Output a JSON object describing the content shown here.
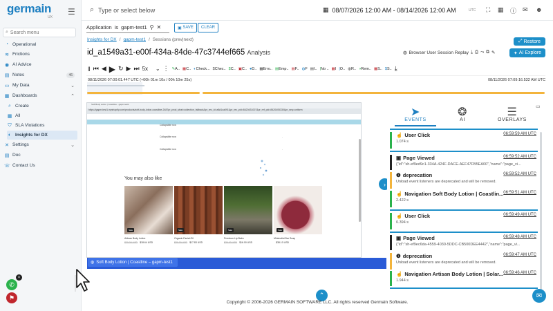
{
  "app": {
    "name": "germain",
    "sub": "UX"
  },
  "topbar": {
    "search_placeholder": "Type or select below",
    "daterange": "08/07/2026 12:00 AM - 08/14/2026 12:00 AM",
    "timezone": "UTC"
  },
  "sidebar": {
    "search": "Search menu",
    "items": [
      {
        "label": "Operational",
        "icon": "gauge-icon"
      },
      {
        "label": "Frictions",
        "icon": "friction-icon"
      },
      {
        "label": "AI Advice",
        "icon": "ai-icon"
      },
      {
        "label": "Notes",
        "icon": "note-icon",
        "badge": "46"
      },
      {
        "label": "My Data",
        "icon": "folder-icon"
      },
      {
        "label": "Dashboards",
        "icon": "dashboard-icon"
      },
      {
        "label": "Create",
        "icon": "search-icon"
      },
      {
        "label": "All",
        "icon": "grid-icon"
      },
      {
        "label": "SLA Violations",
        "icon": "shield-icon"
      },
      {
        "label": "Insights for DX",
        "icon": "insight-icon"
      },
      {
        "label": "Settings",
        "icon": "gear-icon"
      },
      {
        "label": "Doc",
        "icon": "doc-icon"
      },
      {
        "label": "Contact Us",
        "icon": "phone-icon"
      }
    ]
  },
  "filter": {
    "field": "Application",
    "op": "is",
    "value": "gapm-test1",
    "save": "SAVE",
    "clear": "CLEAR"
  },
  "breadcrumb": {
    "c1": "Insights for DX",
    "c2": "gapm-test1",
    "c3": "Sessions (prev|next)"
  },
  "restore_label": "Restore",
  "title": {
    "id": "id_a1549a31-e00f-434a-84de-47c3744ef665",
    "suffix": "Analysis"
  },
  "replay_label": "Browser User Session Replay",
  "ai_explore_label": "AI Explore",
  "player": {
    "speed": "5x",
    "chips": [
      "A..",
      "C..",
      "Check...",
      "Chec..",
      "C..",
      "C..",
      "D..",
      "Erro..",
      "Emp..",
      "F..",
      "F",
      "I..",
      "No ..",
      "I",
      "O..",
      "R..",
      "Rem..",
      "S..",
      "S.."
    ]
  },
  "timeline": {
    "start": "08/11/2026 07:00:01.447 UTC (+00h 01m 10s / 00h 10m 25s)",
    "end": "08/11/2026 07:09:16.532 AM UTC"
  },
  "frame": {
    "tab_title": "Soft Body Lotion | Coastline - gapm-test1",
    "url": "https://gapm-test1.myshopify.com/products/soft-body-lotion-coastline-2487pr_prod_strat=collection_fallback&pr_rec_id=a8d1ca091&pr_rec_pid=8420431007&pr_ref_pid=8420405330&pr_seq=uniform",
    "collapsible": [
      "Collapsible row",
      "Collapsible row",
      "Collapsible row"
    ],
    "may_like": "You may also like",
    "products": [
      {
        "name": "Artisan Body Lotion",
        "old": "$20.00 USD",
        "price": "$18.64 USD",
        "sale": "Sale"
      },
      {
        "name": "Organic Facial Oil",
        "old": "$20.00 USD",
        "price": "$17.83 USD",
        "sale": "Sale"
      },
      {
        "name": "Premium Lip Balm",
        "old": "$20.00 USD",
        "price": "$16.00 USD",
        "sale": "Sale"
      },
      {
        "name": "Minimalist Bar Soap",
        "old": "",
        "price": "$38.10 USD",
        "sale": "Sale"
      }
    ],
    "session_tab": "Soft Body Lotion | Coastline – gapm-test1"
  },
  "rpanel": {
    "tabs": [
      "EVENTS",
      "AI",
      "OVERLAYS"
    ],
    "events": [
      {
        "title": "User Click",
        "time": "06:59:59 AM UTC",
        "detail": "1.074 s",
        "icon": "click-icon"
      },
      {
        "title": "Page Viewed",
        "time": "06:59:52 AM UTC",
        "detail": "{\"id\":\"sh-ef9ed9c1-334A-424F-DACE-AEF47FB5EA00\",\"name\":\"page_vi...",
        "icon": "page-icon"
      },
      {
        "title": "deprecation",
        "time": "06:59:52 AM UTC",
        "detail": "Unload event listeners are deprecated and will be removed.",
        "icon": "info-icon"
      },
      {
        "title": "Navigation Soft Body Lotion | Coastlin...",
        "time": "06:59:51 AM UTC",
        "detail": "2.422 s",
        "icon": "nav-icon"
      },
      {
        "title": "User Click",
        "time": "06:59:49 AM UTC",
        "detail": "0.394 s",
        "icon": "click-icon"
      },
      {
        "title": "Page Viewed",
        "time": "06:59:48 AM UTC",
        "detail": "{\"id\":\"sh-ef9ec6da-4559-4030-5DDC-CB500DEE4442\",\"name\":\"page_vi...",
        "icon": "page-icon"
      },
      {
        "title": "deprecation",
        "time": "06:59:47 AM UTC",
        "detail": "Unload event listeners are deprecated and will be removed.",
        "icon": "info-icon"
      },
      {
        "title": "Navigation Artisan Body Lotion | Solar...",
        "time": "06:59:46 AM UTC",
        "detail": "1.944 s",
        "icon": "nav-icon"
      }
    ]
  },
  "footer": "Copyright © 2006-2026 GERMAIN SOFTWARE LLC. All rights reserved Germain Software.",
  "colors": {
    "accent": "#1d8fc9",
    "timeline": "#f3b43c",
    "success": "#2bb24c",
    "warning": "#f3b43c"
  }
}
